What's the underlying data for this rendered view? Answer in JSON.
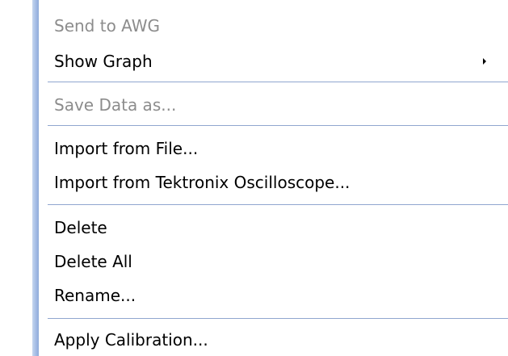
{
  "menu": {
    "items": [
      {
        "label": "Send to AWG",
        "enabled": false
      },
      {
        "label": "Show Graph",
        "enabled": true,
        "has_submenu": true
      },
      {
        "label": "Save Data as...",
        "enabled": false
      },
      {
        "label": "Import from File...",
        "enabled": true
      },
      {
        "label": "Import from Tektronix Oscilloscope...",
        "enabled": true
      },
      {
        "label": "Delete",
        "enabled": true
      },
      {
        "label": "Delete All",
        "enabled": true
      },
      {
        "label": "Rename...",
        "enabled": true
      },
      {
        "label": "Apply Calibration...",
        "enabled": true
      }
    ],
    "submenu_arrow_icon": "chevron-right-icon",
    "colors": {
      "disabled_text": "#8c8c8c",
      "separator": "#90a6cf",
      "side_strip": "#8eaadb"
    }
  }
}
